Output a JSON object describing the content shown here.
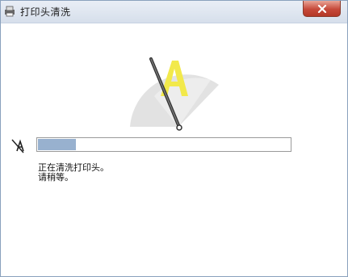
{
  "window": {
    "title": "打印头清洗"
  },
  "controls": {
    "close_icon": "close-icon"
  },
  "progress": {
    "value_fraction": 0.15
  },
  "status": {
    "line1": "正在清洗打印头。",
    "line2": "请稍等。"
  },
  "icons": {
    "app": "printer-app-icon",
    "animation": "printhead-cleaning-animation",
    "pause": "pause-cleaning-icon"
  },
  "colors": {
    "progress_fill": "#98b1cf",
    "close_button": "#c6493a",
    "animation_letter": "#f2e94b"
  }
}
